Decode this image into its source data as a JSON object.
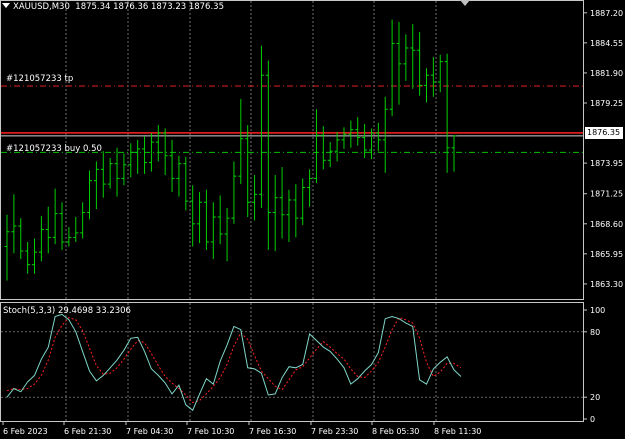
{
  "chart_header": {
    "symbol": "XAUUSD,M30",
    "ohlc": "1875.34 1876.36 1873.23 1876.35"
  },
  "orders": {
    "tp_label": "#121057233 tp",
    "buy_label": "#121057233 buy 0.50"
  },
  "current_price": "1876.35",
  "stochastic": {
    "title": "Stoch(5,3,3) 29.4698 33.2306",
    "levels": [
      "100",
      "80",
      "20",
      "0"
    ]
  },
  "price_axis": [
    "1887.20",
    "1884.55",
    "1881.90",
    "1879.25",
    "1873.95",
    "1871.25",
    "1868.60",
    "1865.95",
    "1863.30"
  ],
  "time_axis": [
    "6 Feb 2023",
    "6 Feb 21:30",
    "7 Feb 04:30",
    "7 Feb 10:30",
    "7 Feb 16:30",
    "7 Feb 23:30",
    "8 Feb 05:30",
    "8 Feb 11:30"
  ],
  "colors": {
    "bars": "#00d000",
    "tp_line": "#e02020",
    "buy_line": "#00c000",
    "bid_line": "#ff2020",
    "stoch_main": "#7fd6c8",
    "stoch_signal": "#ff2020",
    "grid": "#c8c8c8"
  },
  "chart_data": {
    "type": "ohlc",
    "timeframe": "M30",
    "ylim": [
      1862.5,
      1887.8
    ],
    "tp_level": 1880.75,
    "buy_level": 1874.9,
    "bid_level": 1876.35,
    "ohlc": [
      [
        1866.6,
        1869.4,
        1863.6,
        1867.9
      ],
      [
        1867.9,
        1871.2,
        1866.0,
        1868.4
      ],
      [
        1868.4,
        1869.1,
        1865.5,
        1866.2
      ],
      [
        1866.2,
        1867.0,
        1864.2,
        1865.0
      ],
      [
        1865.0,
        1867.3,
        1864.2,
        1866.1
      ],
      [
        1866.1,
        1869.3,
        1865.3,
        1868.1
      ],
      [
        1868.1,
        1870.1,
        1866.0,
        1867.4
      ],
      [
        1867.4,
        1871.7,
        1866.8,
        1869.5
      ],
      [
        1869.5,
        1870.5,
        1866.3,
        1867.0
      ],
      [
        1867.0,
        1868.3,
        1866.6,
        1867.4
      ],
      [
        1867.4,
        1869.2,
        1867.0,
        1867.8
      ],
      [
        1867.8,
        1870.5,
        1867.3,
        1869.6
      ],
      [
        1869.6,
        1873.3,
        1869.0,
        1872.4
      ],
      [
        1872.4,
        1874.1,
        1869.9,
        1873.4
      ],
      [
        1873.4,
        1875.0,
        1870.9,
        1872.1
      ],
      [
        1872.1,
        1874.4,
        1871.7,
        1873.9
      ],
      [
        1873.9,
        1875.3,
        1871.0,
        1872.6
      ],
      [
        1872.6,
        1874.8,
        1872.0,
        1873.8
      ],
      [
        1873.8,
        1875.7,
        1872.7,
        1874.9
      ],
      [
        1874.9,
        1876.0,
        1873.0,
        1875.2
      ],
      [
        1875.2,
        1876.3,
        1873.0,
        1874.0
      ],
      [
        1874.0,
        1876.6,
        1873.2,
        1875.8
      ],
      [
        1875.8,
        1877.3,
        1874.1,
        1876.6
      ],
      [
        1876.6,
        1877.0,
        1872.9,
        1874.6
      ],
      [
        1874.6,
        1876.0,
        1871.4,
        1872.6
      ],
      [
        1872.6,
        1874.6,
        1871.0,
        1873.9
      ],
      [
        1873.9,
        1874.5,
        1869.8,
        1870.6
      ],
      [
        1870.6,
        1872.0,
        1866.6,
        1868.6
      ],
      [
        1868.6,
        1871.4,
        1866.9,
        1870.5
      ],
      [
        1870.5,
        1871.6,
        1866.3,
        1867.0
      ],
      [
        1867.0,
        1870.5,
        1865.5,
        1869.2
      ],
      [
        1869.2,
        1871.1,
        1866.8,
        1867.7
      ],
      [
        1867.7,
        1870.0,
        1865.3,
        1869.1
      ],
      [
        1869.1,
        1874.1,
        1868.6,
        1872.8
      ],
      [
        1872.8,
        1879.6,
        1872.1,
        1876.1
      ],
      [
        1876.1,
        1877.3,
        1869.2,
        1870.5
      ],
      [
        1870.5,
        1872.9,
        1868.9,
        1871.2
      ],
      [
        1871.2,
        1884.3,
        1870.0,
        1881.7
      ],
      [
        1881.7,
        1883.0,
        1866.3,
        1869.6
      ],
      [
        1869.6,
        1872.9,
        1866.2,
        1870.9
      ],
      [
        1870.9,
        1873.6,
        1867.3,
        1869.4
      ],
      [
        1869.4,
        1871.6,
        1867.0,
        1870.7
      ],
      [
        1870.7,
        1872.1,
        1867.4,
        1869.1
      ],
      [
        1869.1,
        1872.6,
        1868.5,
        1871.8
      ],
      [
        1871.8,
        1873.4,
        1870.1,
        1872.6
      ],
      [
        1872.6,
        1878.7,
        1872.2,
        1876.4
      ],
      [
        1876.4,
        1877.2,
        1873.4,
        1874.2
      ],
      [
        1874.2,
        1875.8,
        1873.6,
        1875.0
      ],
      [
        1875.0,
        1876.7,
        1874.1,
        1876.0
      ],
      [
        1876.0,
        1877.1,
        1875.2,
        1876.5
      ],
      [
        1876.5,
        1877.7,
        1875.3,
        1876.9
      ],
      [
        1876.9,
        1878.0,
        1875.5,
        1876.2
      ],
      [
        1876.2,
        1877.4,
        1874.4,
        1875.1
      ],
      [
        1875.1,
        1877.0,
        1874.3,
        1876.6
      ],
      [
        1876.6,
        1877.5,
        1875.0,
        1876.0
      ],
      [
        1876.0,
        1879.8,
        1873.1,
        1878.7
      ],
      [
        1878.7,
        1886.6,
        1878.1,
        1884.5
      ],
      [
        1884.5,
        1886.4,
        1879.1,
        1882.7
      ],
      [
        1882.7,
        1885.3,
        1881.2,
        1884.1
      ],
      [
        1884.1,
        1886.2,
        1880.5,
        1883.9
      ],
      [
        1883.9,
        1885.5,
        1879.9,
        1880.8
      ],
      [
        1880.8,
        1882.3,
        1879.3,
        1881.7
      ],
      [
        1881.7,
        1883.3,
        1879.8,
        1881.1
      ],
      [
        1881.1,
        1883.5,
        1880.2,
        1882.9
      ],
      [
        1882.9,
        1883.6,
        1873.1,
        1875.3
      ],
      [
        1875.3,
        1876.4,
        1873.2,
        1876.35
      ]
    ],
    "stochastic": {
      "main": [
        20,
        28,
        25,
        34,
        40,
        55,
        66,
        94,
        96,
        91,
        80,
        62,
        44,
        35,
        40,
        47,
        54,
        63,
        74,
        75,
        62,
        46,
        40,
        33,
        23,
        31,
        13,
        8,
        23,
        37,
        32,
        53,
        68,
        85,
        82,
        47,
        46,
        42,
        22,
        23,
        38,
        48,
        47,
        50,
        78,
        72,
        66,
        62,
        55,
        47,
        32,
        37,
        44,
        50,
        61,
        92,
        94,
        92,
        88,
        85,
        36,
        32,
        46,
        52,
        57,
        45,
        39
      ],
      "signal": [
        26,
        28,
        27,
        28,
        32,
        40,
        54,
        75,
        86,
        93,
        91,
        81,
        65,
        49,
        41,
        42,
        47,
        55,
        64,
        72,
        70,
        60,
        49,
        39,
        33,
        28,
        22,
        15,
        17,
        23,
        30,
        38,
        50,
        67,
        79,
        73,
        58,
        44,
        37,
        30,
        27,
        36,
        45,
        48,
        56,
        64,
        71,
        66,
        60,
        55,
        46,
        39,
        38,
        44,
        52,
        66,
        82,
        93,
        91,
        88,
        74,
        52,
        39,
        43,
        51,
        51,
        47
      ],
      "levels": [
        100,
        80,
        20,
        0
      ]
    },
    "x_labels": [
      "6 Feb 2023",
      "6 Feb 21:30",
      "7 Feb 04:30",
      "7 Feb 10:30",
      "7 Feb 16:30",
      "7 Feb 23:30",
      "8 Feb 05:30",
      "8 Feb 11:30"
    ]
  }
}
